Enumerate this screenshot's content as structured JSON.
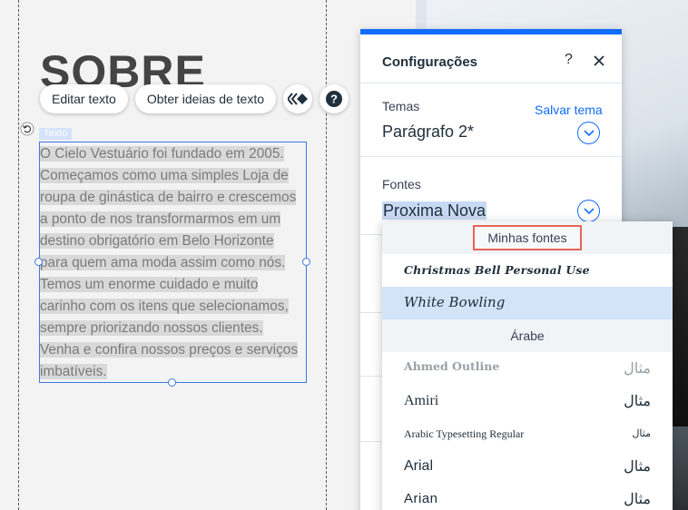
{
  "editor": {
    "heading": "SOBRE",
    "toolbar": {
      "edit_text": "Editar texto",
      "text_ideas": "Obter ideias de texto"
    },
    "element_tag": "Texto",
    "paragraph_lines": [
      "O Cielo Vestuário foi fundado em 2005.",
      "Começamos como uma simples Loja de",
      "roupa de ginástica de bairro e crescemos",
      "a ponto de nos transformarmos em um",
      "destino obrigatório em Belo Horizonte",
      "para quem ama moda assim como nós.",
      "Temos um enorme cuidado e muito",
      "carinho com os itens que selecionamos,",
      "sempre priorizando nossos clientes.",
      "Venha e confira nossos preços e serviços",
      "imbatíveis."
    ]
  },
  "panel": {
    "title": "Configurações",
    "help": "?",
    "themes_label": "Temas",
    "save_theme": "Salvar tema",
    "theme_value": "Parágrafo 2*",
    "fonts_label": "Fontes",
    "font_value": "Proxima Nova",
    "accent_color": "#116dff"
  },
  "font_dropdown": {
    "my_fonts_header": "Minhas fontes",
    "my_fonts": [
      {
        "name": "Christmas Bell Personal Use",
        "selected": false
      },
      {
        "name": "White Bowling",
        "selected": true
      }
    ],
    "arabic_header": "Árabe",
    "arabic_fonts": [
      {
        "name": "Ahmed Outline",
        "sample": "مثال"
      },
      {
        "name": "Amiri",
        "sample": "مثال"
      },
      {
        "name": "Arabic Typesetting Regular",
        "sample": "مثال"
      },
      {
        "name": "Arial",
        "sample": "مثال"
      },
      {
        "name": "Arian",
        "sample": "مثال"
      }
    ]
  }
}
